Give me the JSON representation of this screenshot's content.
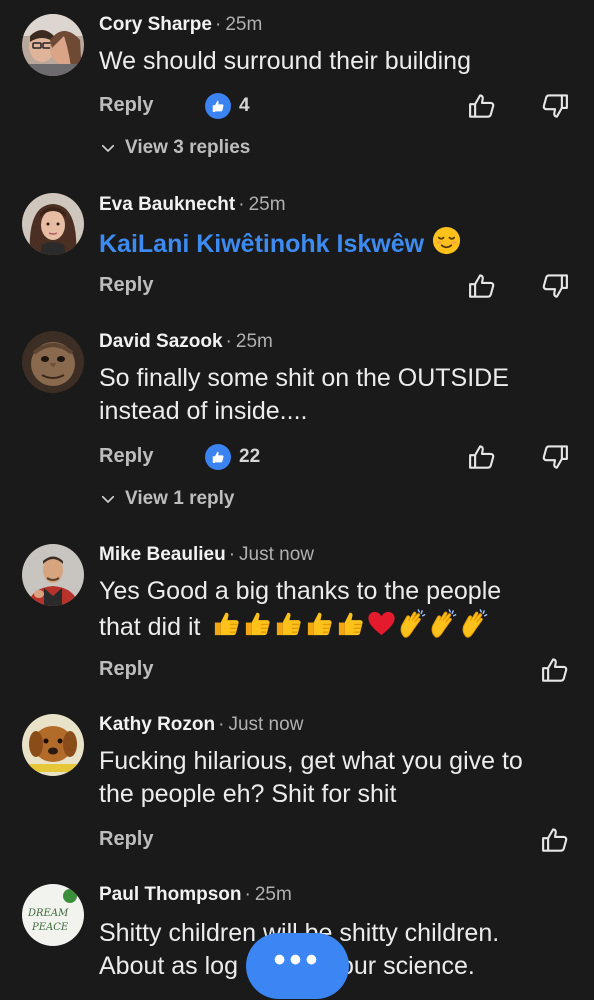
{
  "accent_color": "#3b86f3",
  "mention_color": "#3d8bf0",
  "labels": {
    "reply": "Reply"
  },
  "comments": [
    {
      "author": "Cory Sharpe",
      "time": "25m",
      "body": "We should surround their building",
      "likes": "4",
      "view_replies": "View 3 replies",
      "avatar_icon": "couple-photo"
    },
    {
      "author": "Eva Bauknecht",
      "time": "25m",
      "body": "KaiLani Kiwêtinohk Iskwêw",
      "emoji": "relieved-face",
      "avatar_icon": "woman-photo"
    },
    {
      "author": "David Sazook",
      "time": "25m",
      "body": "So finally some shit on the OUTSIDE instead of inside....",
      "likes": "22",
      "view_replies": "View 1 reply",
      "avatar_icon": "creature-photo"
    },
    {
      "author": "Mike Beaulieu",
      "time": "Just now",
      "body_line1": "Yes Good a big thanks  to the people",
      "body_line2": "that did it",
      "emojis": [
        "thumbs-up",
        "thumbs-up",
        "thumbs-up",
        "thumbs-up",
        "thumbs-up",
        "red-heart",
        "clapping-hands",
        "clapping-hands",
        "clapping-hands"
      ],
      "avatar_icon": "man-photo"
    },
    {
      "author": "Kathy Rozon",
      "time": "Just now",
      "body": "Fucking hilarious, get what you give to the people eh? Shit for shit",
      "avatar_icon": "dog-photo"
    },
    {
      "author": "Paul Thompson",
      "time": "25m",
      "body_line1": "Shitty children will be shitty children.",
      "body_line2": "About as log",
      "body_line2_end": "our science.",
      "avatar_icon": "dream-peace-photo"
    }
  ],
  "fab": {
    "label": "•••"
  }
}
